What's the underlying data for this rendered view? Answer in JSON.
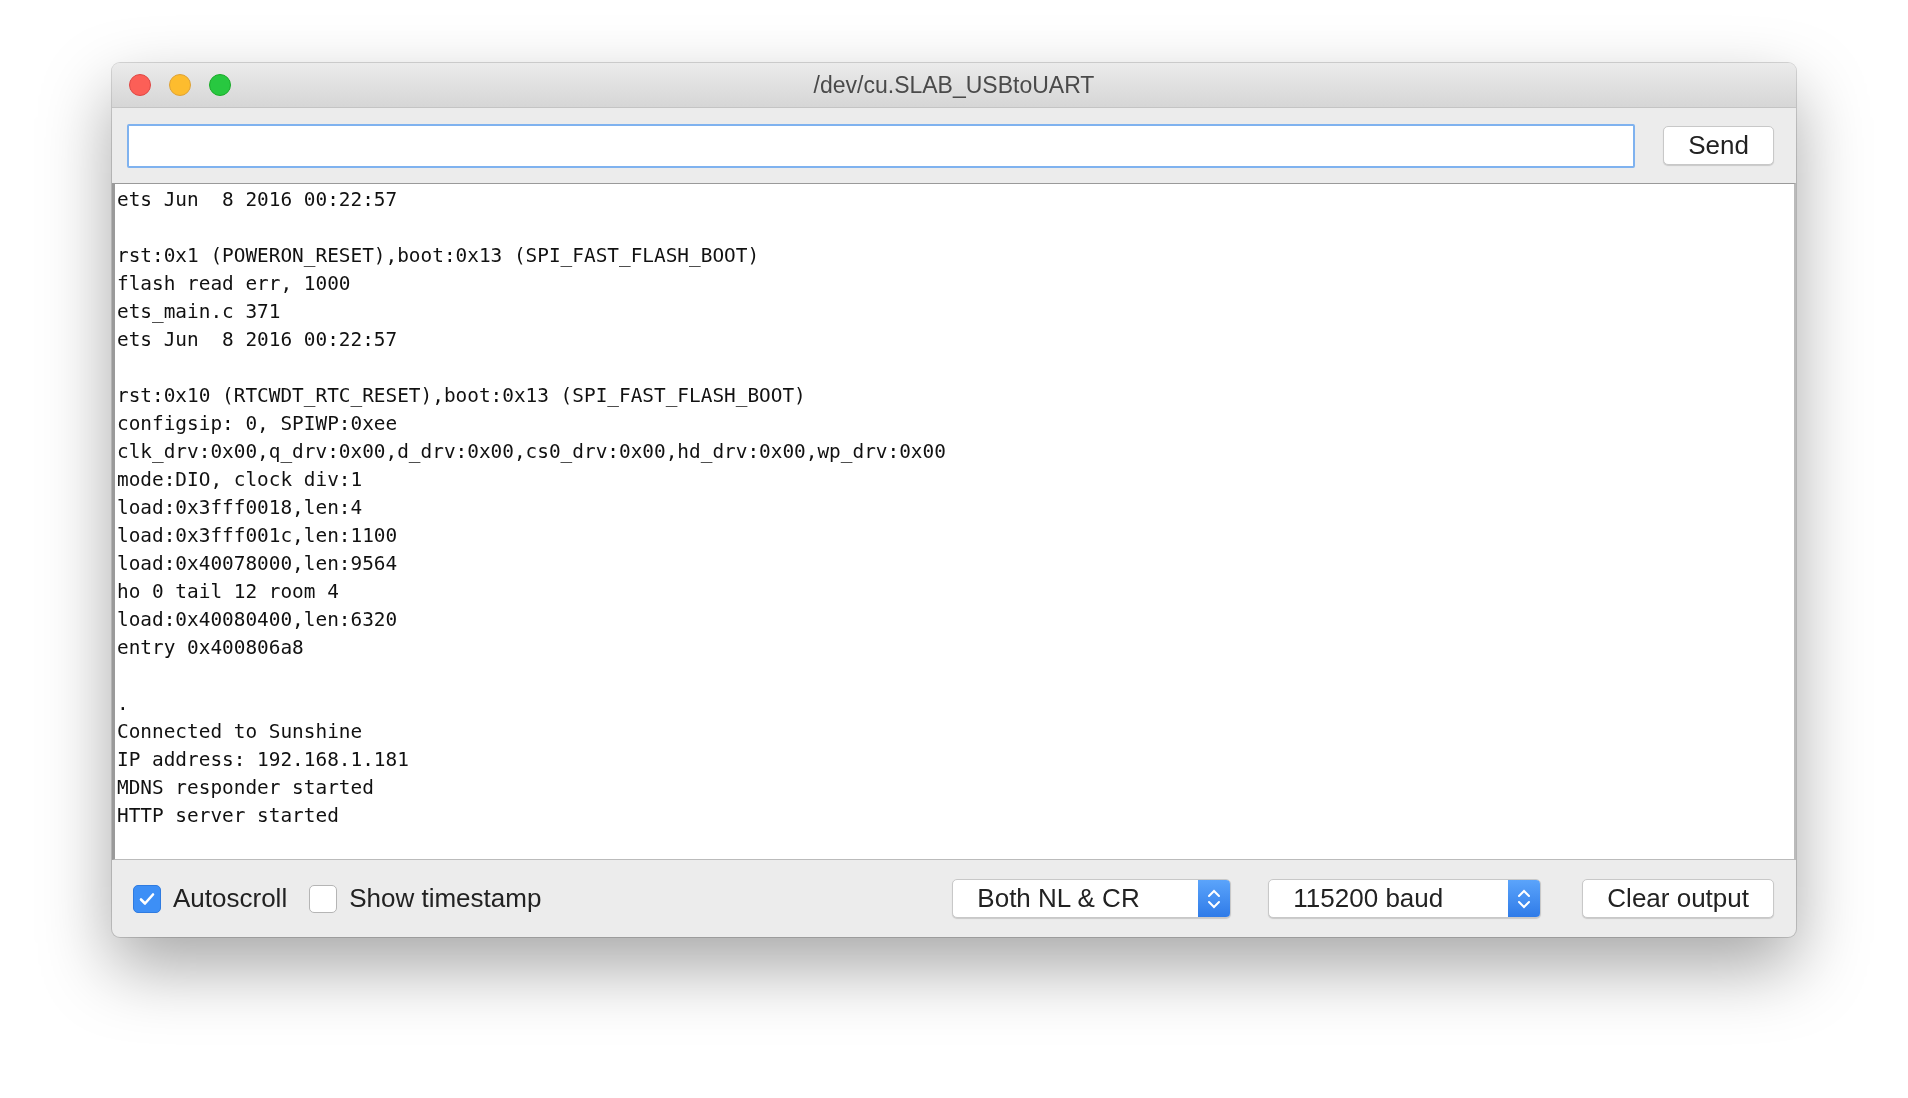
{
  "window": {
    "title": "/dev/cu.SLAB_USBtoUART"
  },
  "send_button": "Send",
  "output": [
    [
      "ets Jun  8 2016 00:22:57"
    ],
    [
      "rst:0x1 (POWERON_RESET),boot:0x13 (SPI_FAST_FLASH_BOOT)",
      "flash read err, 1000",
      "ets_main.c 371",
      "ets Jun  8 2016 00:22:57"
    ],
    [
      "rst:0x10 (RTCWDT_RTC_RESET),boot:0x13 (SPI_FAST_FLASH_BOOT)",
      "configsip: 0, SPIWP:0xee",
      "clk_drv:0x00,q_drv:0x00,d_drv:0x00,cs0_drv:0x00,hd_drv:0x00,wp_drv:0x00",
      "mode:DIO, clock div:1",
      "load:0x3fff0018,len:4",
      "load:0x3fff001c,len:1100",
      "load:0x40078000,len:9564",
      "ho 0 tail 12 room 4",
      "load:0x40080400,len:6320",
      "entry 0x400806a8"
    ],
    [
      ".",
      "Connected to Sunshine",
      "IP address: 192.168.1.181",
      "MDNS responder started",
      "HTTP server started"
    ]
  ],
  "checkboxes": [
    {
      "label": "Autoscroll",
      "checked": true
    },
    {
      "label": "Show timestamp",
      "checked": false
    }
  ],
  "selects": [
    {
      "value": "Both NL & CR"
    },
    {
      "value": "115200 baud"
    }
  ],
  "clear_button": "Clear output"
}
